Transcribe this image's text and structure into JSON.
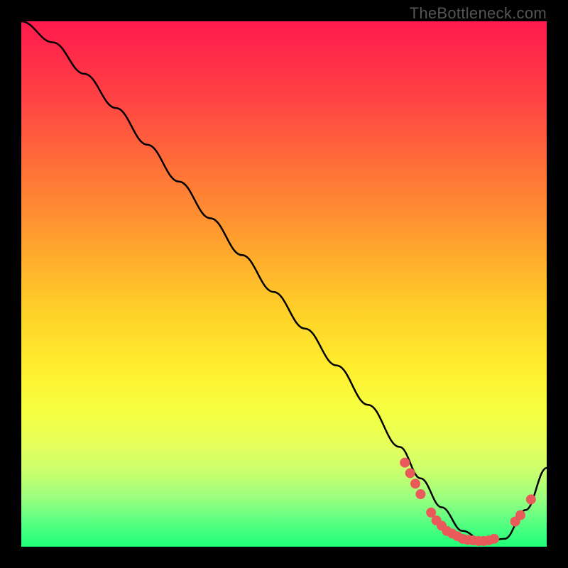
{
  "watermark": "TheBottleneck.com",
  "chart_data": {
    "type": "line",
    "title": "",
    "xlabel": "",
    "ylabel": "",
    "xlim": [
      0,
      100
    ],
    "ylim": [
      0,
      100
    ],
    "series": [
      {
        "name": "curve",
        "x": [
          0,
          6,
          12,
          18,
          24,
          30,
          36,
          42,
          48,
          54,
          60,
          66,
          72,
          76,
          80,
          84,
          88,
          92,
          96,
          100
        ],
        "y": [
          100,
          96,
          90,
          83.5,
          76.5,
          69.5,
          62.5,
          55.5,
          48.5,
          41.5,
          34.5,
          27,
          19,
          13,
          7.5,
          3,
          1,
          1.5,
          7,
          15
        ]
      }
    ],
    "markers": [
      {
        "x": 73,
        "y": 16
      },
      {
        "x": 74,
        "y": 14
      },
      {
        "x": 75,
        "y": 12
      },
      {
        "x": 76,
        "y": 10
      },
      {
        "x": 78,
        "y": 6.5
      },
      {
        "x": 79,
        "y": 5
      },
      {
        "x": 80,
        "y": 4
      },
      {
        "x": 81,
        "y": 3
      },
      {
        "x": 82,
        "y": 2.5
      },
      {
        "x": 83,
        "y": 2
      },
      {
        "x": 84,
        "y": 1.5
      },
      {
        "x": 85,
        "y": 1.3
      },
      {
        "x": 86,
        "y": 1.2
      },
      {
        "x": 87,
        "y": 1.1
      },
      {
        "x": 88,
        "y": 1.1
      },
      {
        "x": 89,
        "y": 1.2
      },
      {
        "x": 90,
        "y": 1.5
      },
      {
        "x": 94,
        "y": 4.8
      },
      {
        "x": 95,
        "y": 6
      },
      {
        "x": 97,
        "y": 9
      }
    ],
    "marker_style": {
      "color": "#ea5a5a",
      "radius": 7
    },
    "line_style": {
      "color": "#000000",
      "width": 2.5
    }
  }
}
